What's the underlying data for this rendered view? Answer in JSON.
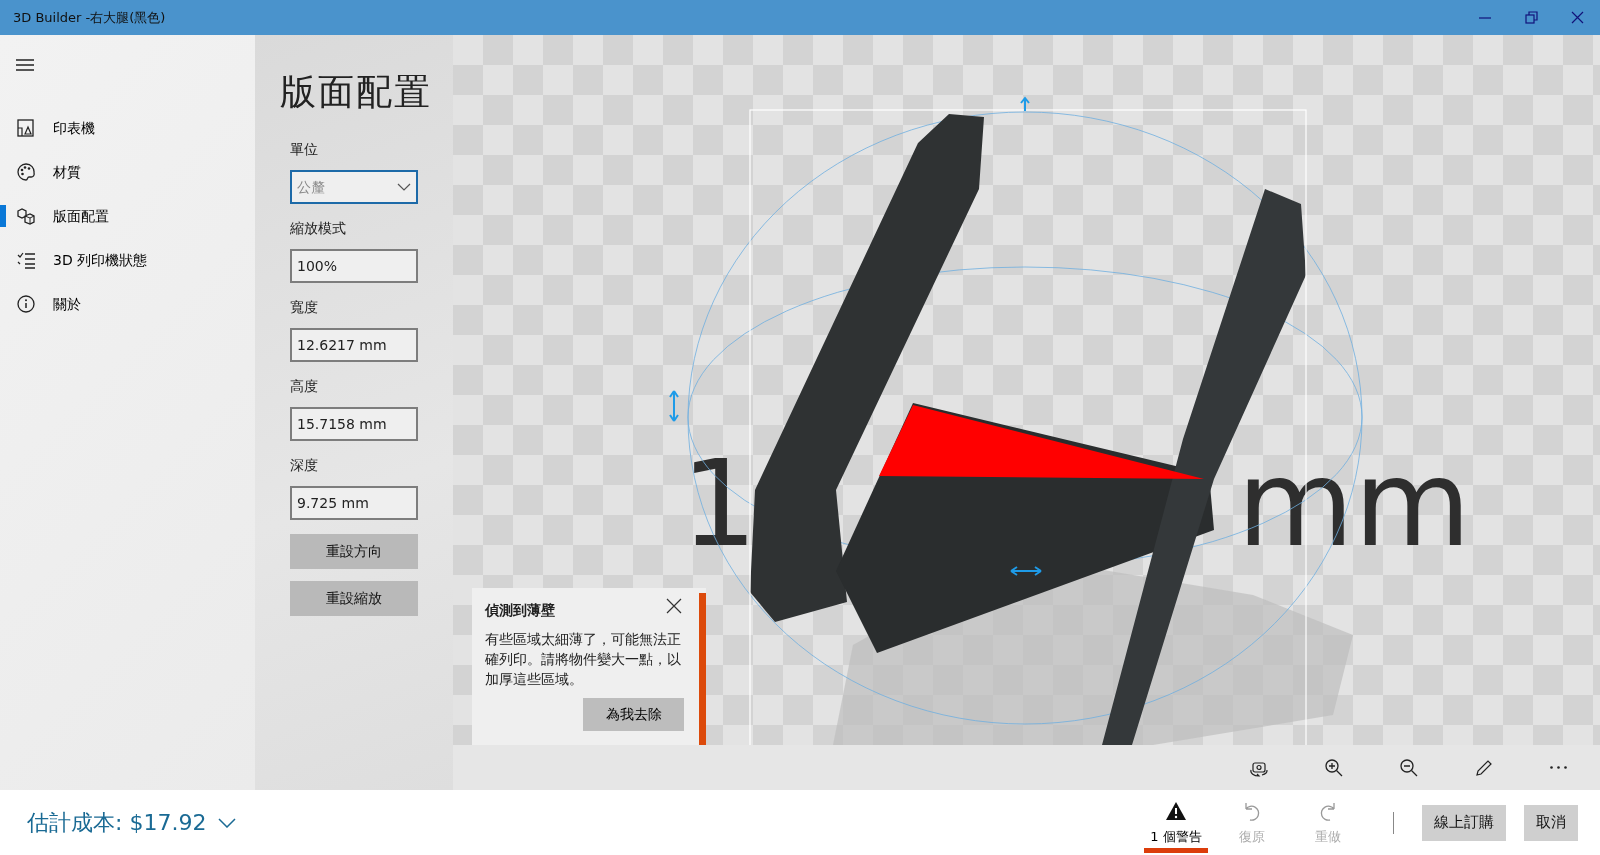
{
  "window": {
    "title": "3D Builder -右大腿(黑色)"
  },
  "sidebar": {
    "items": [
      {
        "label": "印表機",
        "selected": false
      },
      {
        "label": "材質",
        "selected": false
      },
      {
        "label": "版面配置",
        "selected": true
      },
      {
        "label": "3D 列印機狀態",
        "selected": false
      },
      {
        "label": "關於",
        "selected": false
      }
    ]
  },
  "panel": {
    "title": "版面配置",
    "fields": [
      {
        "label": "單位",
        "kind": "select",
        "value": "公釐"
      },
      {
        "label": "縮放模式",
        "kind": "input",
        "value": "100%"
      },
      {
        "label": "寬度",
        "kind": "input",
        "value": "12.6217 mm"
      },
      {
        "label": "高度",
        "kind": "input",
        "value": "15.7158 mm"
      },
      {
        "label": "深度",
        "kind": "input",
        "value": "9.725 mm"
      }
    ],
    "buttons": [
      "重設方向",
      "重設縮放"
    ]
  },
  "viewport": {
    "scene_labels": [
      "1",
      "mm"
    ]
  },
  "warning_popup": {
    "title": "偵測到薄壁",
    "message": "有些區域太細薄了，可能無法正確列印。請將物件變大一點，以加厚這些區域。",
    "action": "為我去除"
  },
  "bottom_bar": {
    "cost": "估計成本: $17.92",
    "actions": [
      {
        "label": "1 個警告",
        "kind": "warning",
        "selected": true,
        "disabled": false
      },
      {
        "label": "復原",
        "kind": "undo",
        "selected": false,
        "disabled": true
      },
      {
        "label": "重做",
        "kind": "redo",
        "selected": false,
        "disabled": true
      }
    ],
    "buttons": [
      "線上訂購",
      "取消"
    ]
  }
}
